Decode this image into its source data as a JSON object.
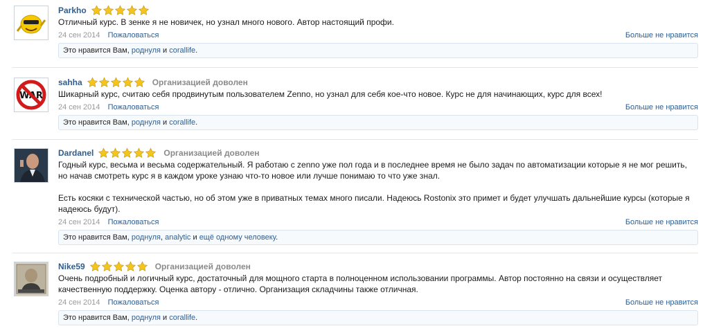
{
  "common": {
    "complain_label": "Пожаловаться",
    "unlike_label": "Больше не нравится",
    "likes_prefix": "Это нравится Вам,",
    "and_word": "и",
    "comma": ","
  },
  "reviews": [
    {
      "author": "Parkho",
      "rating": 5,
      "status": "",
      "paragraphs": [
        "Отличный курс. В зенке я не новичек, но узнал много нового. Автор настоящий профи."
      ],
      "date": "24 сен 2014",
      "likers": [
        "роднуля",
        "corallife"
      ]
    },
    {
      "author": "sahha",
      "rating": 5,
      "status": "Организацией доволен",
      "paragraphs": [
        "Шикарный курс, считаю себя продвинутым пользователем Zenno, но узнал для себя кое-что новое. Курс не для начинающих, курс для всех!"
      ],
      "date": "24 сен 2014",
      "likers": [
        "роднуля",
        "corallife"
      ]
    },
    {
      "author": "Dardanel",
      "rating": 5,
      "status": "Организацией доволен",
      "paragraphs": [
        "Годный курс, весьма и весьма содержательный. Я работаю с zenno уже пол года и в последнее время не было задач по автоматизации которые я не мог решить, но начав смотреть курс я в каждом уроке узнаю что-то новое или лучше понимаю то что уже знал.",
        "Есть косяки с технической частью, но об этом уже в приватных темах много писали. Надеюсь Rostonix это примет и будет улучшать дальнейшие курсы (которые я надеюсь будут)."
      ],
      "date": "24 сен 2014",
      "likers": [
        "роднуля",
        "analytic",
        "ещё одному человеку"
      ]
    },
    {
      "author": "Nike59",
      "rating": 5,
      "status": "Организацией доволен",
      "paragraphs": [
        "Очень подробный и логичный курс, достаточный для мощного старта в полноценном использовании программы. Автор постоянно на связи и осуществляет качественную поддержку. Оценка автору - отлично. Организация складчины также отличная."
      ],
      "date": "24 сен 2014",
      "likers": [
        "роднуля",
        "corallife"
      ]
    }
  ],
  "colors": {
    "link": "#2c5e93",
    "star": "#f3c61f",
    "status": "#8a8a8a"
  }
}
